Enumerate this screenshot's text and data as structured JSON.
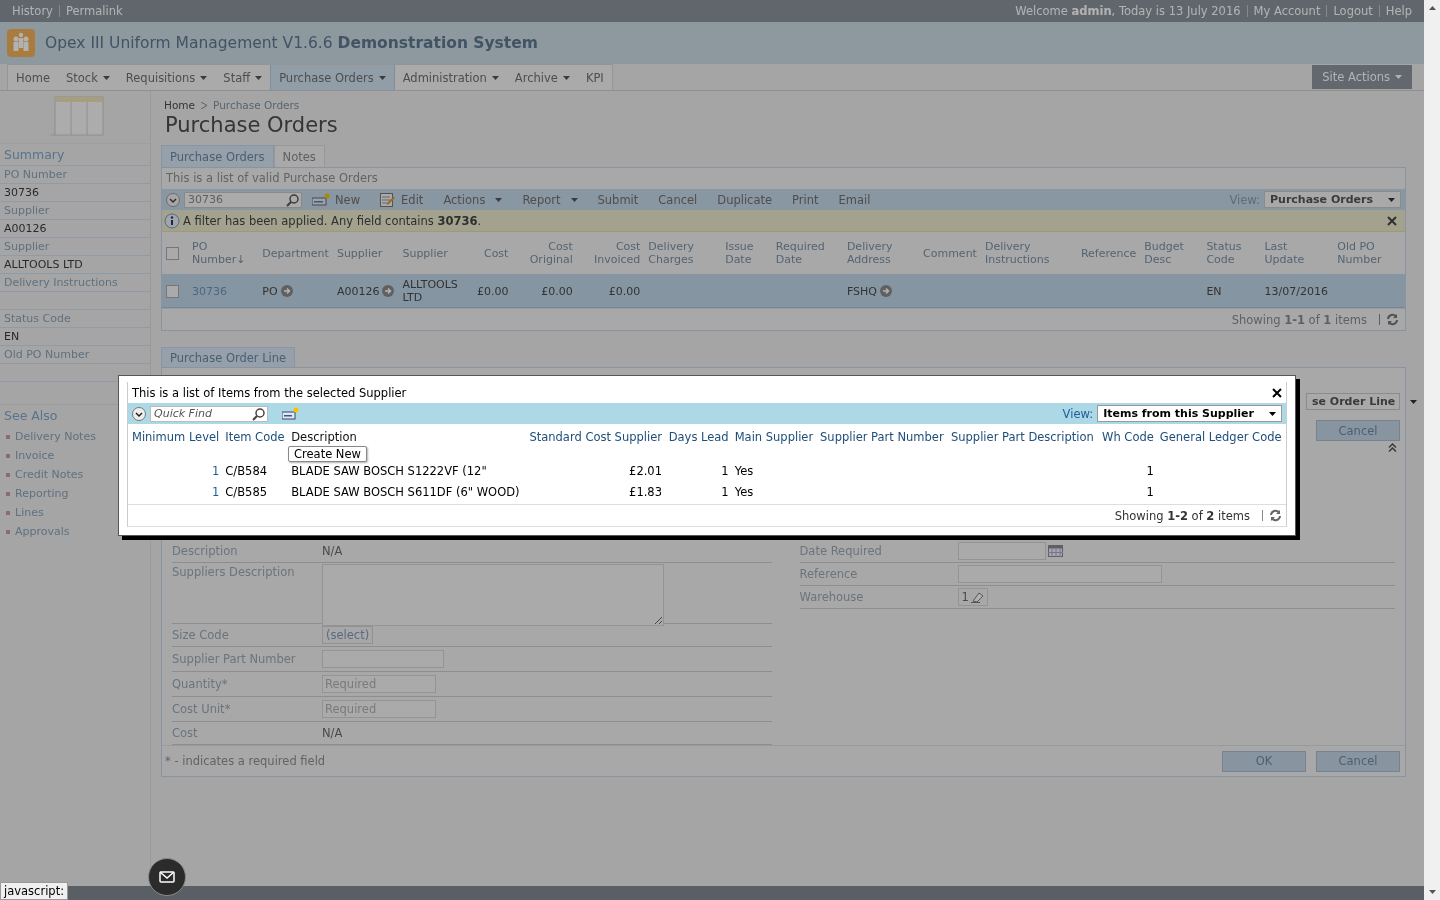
{
  "topbar": {
    "left_links": [
      "History",
      "Permalink"
    ],
    "welcome": "Welcome **admin**, Today is 13 July 2016",
    "right_links": [
      "My Account",
      "Logout",
      "Help"
    ]
  },
  "app_title": "Opex III Uniform Management V1.6.6 **Demonstration System**",
  "nav": [
    {
      "label": "Home",
      "dropdown": false,
      "selected": false
    },
    {
      "label": "Stock",
      "dropdown": true,
      "selected": false
    },
    {
      "label": "Requisitions",
      "dropdown": true,
      "selected": false
    },
    {
      "label": "Staff",
      "dropdown": true,
      "selected": false
    },
    {
      "label": "Purchase Orders",
      "dropdown": true,
      "selected": true
    },
    {
      "label": "Administration",
      "dropdown": true,
      "selected": false
    },
    {
      "label": "Archive",
      "dropdown": true,
      "selected": false
    },
    {
      "label": "KPI",
      "dropdown": false,
      "selected": false
    }
  ],
  "site_actions": "Site Actions",
  "breadcrumb": [
    "Home",
    "Purchase Orders"
  ],
  "page_title": "Purchase Orders",
  "summary": {
    "title": "Summary",
    "fields": [
      {
        "label": "PO Number",
        "value": "30736"
      },
      {
        "label": "Supplier",
        "value": "A00126"
      },
      {
        "label": "Supplier",
        "value": "ALLTOOLS LTD"
      },
      {
        "label": "Delivery Instructions"
      },
      {
        "label": "Status Code",
        "value": "EN"
      },
      {
        "label": "Old PO Number"
      }
    ]
  },
  "see_also": {
    "title": "See Also",
    "links": [
      "Delivery Notes",
      "Invoice",
      "Credit Notes",
      "Reporting",
      "Lines",
      "Approvals"
    ]
  },
  "tabs": [
    {
      "label": "Purchase Orders",
      "selected": true
    },
    {
      "label": "Notes",
      "selected": false
    }
  ],
  "grid": {
    "description": "This is a list of valid Purchase Orders",
    "search_value": "30736",
    "select_all_checked": false,
    "toolbar": [
      {
        "label": "New",
        "kind": "new"
      },
      {
        "label": "Edit",
        "kind": "edit"
      },
      {
        "label": "Actions",
        "kind": "plain",
        "dropdown": true
      },
      {
        "label": "Report",
        "kind": "plain",
        "dropdown": true
      },
      {
        "label": "Submit",
        "kind": "plain"
      },
      {
        "label": "Cancel",
        "kind": "plain"
      },
      {
        "label": "Duplicate",
        "kind": "plain"
      },
      {
        "label": "Print",
        "kind": "plain"
      },
      {
        "label": "Email",
        "kind": "plain"
      }
    ],
    "view_label": "View:",
    "view_value": "Purchase Orders",
    "filter_notice": "A filter has been applied. Any field contains **30736**.",
    "columns": [
      {
        "label": "PO Number↓"
      },
      {
        "label": "Department"
      },
      {
        "label": "Supplier"
      },
      {
        "label": "Supplier"
      },
      {
        "label": "Cost",
        "numeric": true
      },
      {
        "label": "Cost Original",
        "numeric": true
      },
      {
        "label": "Cost Invoiced",
        "numeric": true
      },
      {
        "label": "Delivery Charges"
      },
      {
        "label": "Issue Date"
      },
      {
        "label": "Required Date"
      },
      {
        "label": "Delivery Address"
      },
      {
        "label": "Comment"
      },
      {
        "label": "Delivery Instructions"
      },
      {
        "label": "Reference"
      },
      {
        "label": "Budget Desc"
      },
      {
        "label": "Status Code"
      },
      {
        "label": "Last Update"
      },
      {
        "label": "Old PO Number"
      }
    ],
    "rows": [
      {
        "checked": false,
        "selected": true,
        "cells": [
          {
            "text": "30736",
            "kind": "link"
          },
          {
            "text": "PO",
            "arrow": true
          },
          {
            "text": "A00126",
            "arrow": true
          },
          {
            "text": "ALLTOOLS LTD"
          },
          {
            "text": "£0.00"
          },
          {
            "text": "£0.00"
          },
          {
            "text": "£0.00"
          },
          null,
          null,
          null,
          {
            "text": "FSHQ",
            "arrow": true
          },
          null,
          null,
          null,
          null,
          {
            "text": "EN"
          },
          {
            "text": "13/07/2016"
          },
          null
        ]
      }
    ],
    "pager": "Showing **1-1** of **1** items"
  },
  "lines_panel": {
    "tab": "Purchase Order Line",
    "view_value": "se Order Line",
    "top_button": "Cancel",
    "left_fields": [
      {
        "label": "Description",
        "kind": "text",
        "value": "N/A"
      },
      {
        "label": "Suppliers Description",
        "kind": "textarea"
      },
      {
        "label": "Size Code",
        "kind": "select",
        "value": "(select)"
      },
      {
        "label": "Supplier Part Number",
        "kind": "input"
      },
      {
        "label": "Quantity",
        "kind": "input",
        "required": true,
        "placeholder": "Required"
      },
      {
        "label": "Cost Unit",
        "kind": "input",
        "required": true,
        "placeholder": "Required"
      },
      {
        "label": "Cost",
        "kind": "text",
        "value": "N/A"
      }
    ],
    "right_fields": [
      {
        "label": "Date Required",
        "kind": "date"
      },
      {
        "label": "Reference",
        "kind": "input"
      },
      {
        "label": "Warehouse",
        "kind": "lookup",
        "value": "1"
      }
    ],
    "required_mark": "*",
    "required_note": "* - indicates a required field",
    "buttons": [
      "OK",
      "Cancel"
    ]
  },
  "modal": {
    "description": "This is a list of Items from the selected Supplier",
    "search_placeholder": "Quick Find",
    "view_label": "View:",
    "view_value": "Items from this Supplier",
    "tooltip": "Create New",
    "columns": [
      {
        "label": "Minimum Level",
        "numeric": true
      },
      {
        "label": "Item Code"
      },
      {
        "label": "Description"
      },
      {
        "label": "Standard Cost Supplier",
        "numeric": true
      },
      {
        "label": "Days Lead",
        "numeric": true
      },
      {
        "label": "Main Supplier"
      },
      {
        "label": "Supplier Part Number"
      },
      {
        "label": "Supplier Part Description"
      },
      {
        "label": "Wh Code",
        "numeric": true
      },
      {
        "label": "General Ledger Code"
      }
    ],
    "rows": [
      [
        "1",
        "C/B584",
        "BLADE SAW BOSCH S1222VF (12\"",
        "£2.01",
        "1",
        "Yes",
        null,
        null,
        "1",
        null
      ],
      [
        "1",
        "C/B585",
        "BLADE SAW BOSCH S611DF (6\" WOOD)",
        "£1.83",
        "1",
        "Yes",
        null,
        null,
        "1",
        null
      ]
    ],
    "pager": "Showing **1-2** of **2** items"
  },
  "status_text": "javascript:"
}
